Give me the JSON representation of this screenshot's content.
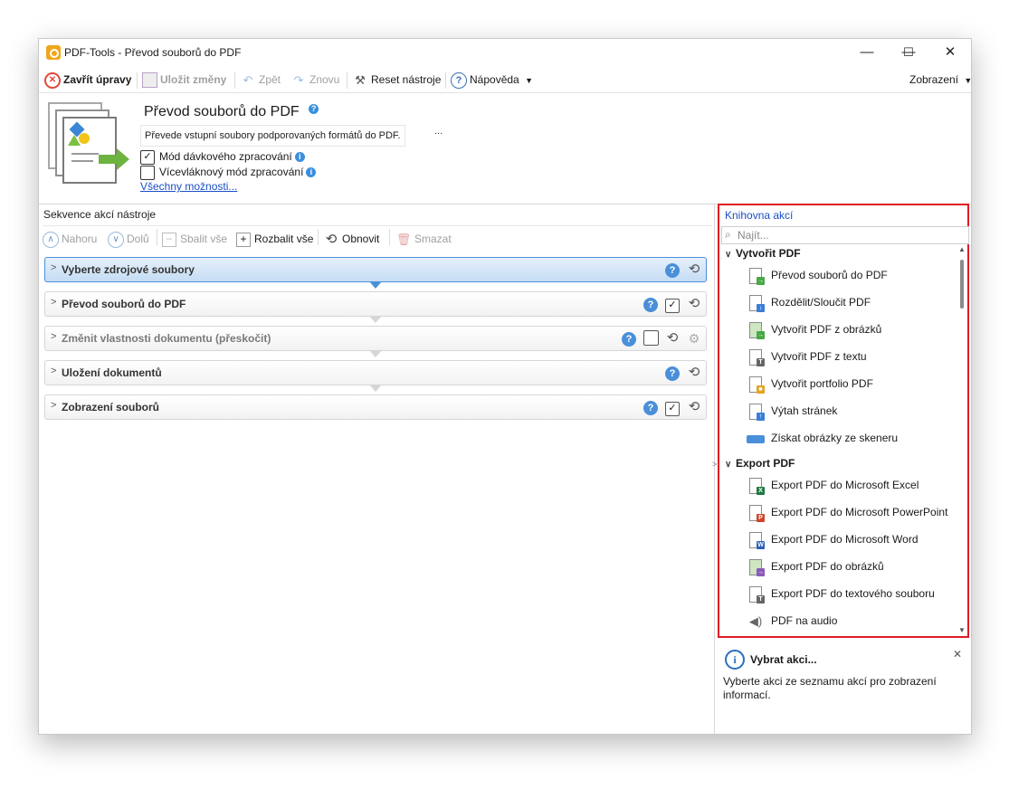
{
  "window": {
    "title": "PDF-Tools - Převod souborů do PDF",
    "minimize": "—",
    "maximize": "☐",
    "close": "✕"
  },
  "toolbar": {
    "close_edits": "Zavřít úpravy",
    "save_changes": "Uložit změny",
    "undo": "Zpět",
    "redo": "Znovu",
    "reset_tool": "Reset nástroje",
    "help": "Nápověda",
    "view": "Zobrazení"
  },
  "tool": {
    "title": "Převod souborů do PDF",
    "description": "Převede vstupní soubory podporovaných formátů do PDF.",
    "more": "...",
    "batch_mode_label": "Mód dávkového zpracování",
    "batch_mode_checked": true,
    "multithread_label": "Vícevláknový mód zpracování",
    "multithread_checked": false,
    "all_options_link": "Všechny možnosti..."
  },
  "sequence": {
    "label": "Sekvence akcí nástroje",
    "toolbar": {
      "up": "Nahoru",
      "down": "Dolů",
      "collapse_all": "Sbalit vše",
      "expand_all": "Rozbalit vše",
      "refresh": "Obnovit",
      "delete": "Smazat"
    },
    "steps": [
      {
        "label": "Vyberte zdrojové soubory",
        "selected": true,
        "checkbox": null
      },
      {
        "label": "Převod souborů do PDF",
        "selected": false,
        "checkbox": true
      },
      {
        "label": "Změnit vlastnosti dokumentu (přeskočit)",
        "selected": false,
        "checkbox": false
      },
      {
        "label": "Uložení dokumentů",
        "selected": false,
        "checkbox": null
      },
      {
        "label": "Zobrazení souborů",
        "selected": false,
        "checkbox": true
      }
    ]
  },
  "library": {
    "title": "Knihovna akcí",
    "search_placeholder": "Najít...",
    "groups": [
      {
        "label": "Vytvořit PDF",
        "items": [
          "Převod souborů do PDF",
          "Rozdělit/Sloučit PDF",
          "Vytvořit PDF z obrázků",
          "Vytvořit PDF z textu",
          "Vytvořit portfolio PDF",
          "Výtah stránek",
          "Získat obrázky ze skeneru"
        ]
      },
      {
        "label": "Export PDF",
        "items": [
          "Export PDF do Microsoft Excel",
          "Export PDF do Microsoft PowerPoint",
          "Export PDF do Microsoft Word",
          "Export PDF do obrázků",
          "Export PDF do textového souboru",
          "PDF na audio"
        ]
      }
    ]
  },
  "info": {
    "title": "Vybrat akci...",
    "text": "Vyberte akci ze seznamu akcí pro zobrazení informací."
  },
  "colors": {
    "accent": "#4a90d9",
    "highlight_border": "#e01b24",
    "link": "#1a4fc4"
  }
}
